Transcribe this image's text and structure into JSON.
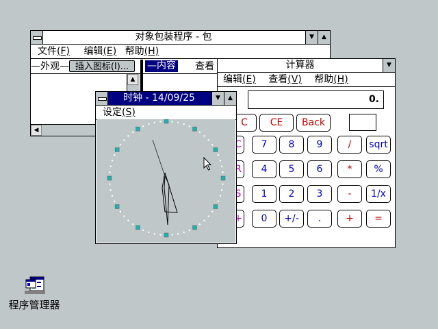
{
  "packager": {
    "title": "对象包装程序 - 包",
    "menu": [
      {
        "label": "文件",
        "key": "(F)"
      },
      {
        "label": "编辑",
        "key": "(E)"
      },
      {
        "label": "帮助",
        "key": "(H)"
      }
    ],
    "appearance_label": "—外观—",
    "insert_icon_button": "插入图标(I)...",
    "content_label": "—内容",
    "view_label": "查看"
  },
  "calculator": {
    "title": "计算器",
    "menu": [
      {
        "label": "编辑",
        "key": "(E)"
      },
      {
        "label": "查看",
        "key": "(V)"
      },
      {
        "label": "帮助",
        "key": "(H)"
      }
    ],
    "display": "0.",
    "buttons": {
      "mc": "C",
      "ce": "CE",
      "back": "Back",
      "mr": "R",
      "ms": "S",
      "mplus": "+",
      "blank_m": "C",
      "n7": "7",
      "n8": "8",
      "n9": "9",
      "div": "/",
      "sqrt": "sqrt",
      "n4": "4",
      "n5": "5",
      "n6": "6",
      "mul": "*",
      "pct": "%",
      "n1": "1",
      "n2": "2",
      "n3": "3",
      "sub": "-",
      "inv": "1/x",
      "n0": "0",
      "neg": "+/-",
      "dot": ".",
      "add": "+",
      "eq": "="
    },
    "colors": {
      "red": "#c00000",
      "blue": "#0000c0",
      "magenta": "#c000c0"
    }
  },
  "clock": {
    "title": "时钟 - 14/09/25",
    "menu": [
      {
        "label": "设定",
        "key": "(S)"
      }
    ]
  },
  "desktop": {
    "progman_label": "程序管理器"
  },
  "colors": {
    "desktop": "#c0c7c8",
    "active_title": "#000080",
    "tick": "#20b0b0"
  }
}
